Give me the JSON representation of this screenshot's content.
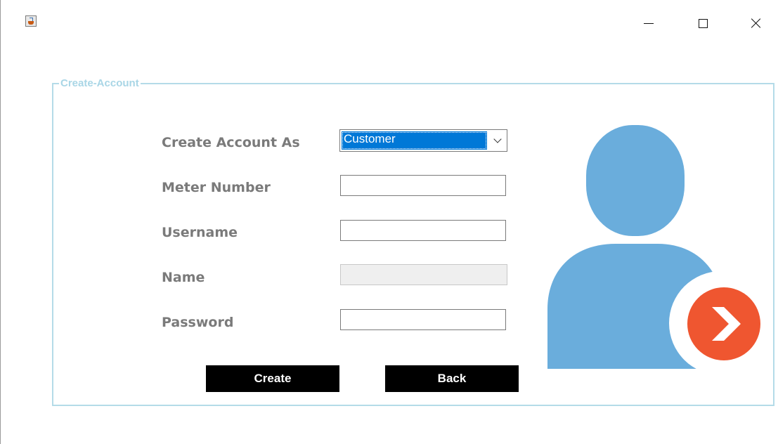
{
  "window": {
    "title": "",
    "app_icon": "java-cup-icon",
    "controls": {
      "minimize_icon": "minimize-icon",
      "maximize_icon": "maximize-icon",
      "close_icon": "close-icon"
    }
  },
  "form": {
    "group_title": "Create-Account",
    "fields": {
      "account_type": {
        "label": "Create Account As",
        "selected": "Customer"
      },
      "meter_number": {
        "label": "Meter Number",
        "value": ""
      },
      "username": {
        "label": "Username",
        "value": ""
      },
      "name": {
        "label": "Name",
        "value": ""
      },
      "password": {
        "label": "Password",
        "value": ""
      }
    },
    "buttons": {
      "create": "Create",
      "back": "Back"
    }
  },
  "illustration": {
    "icon": "user-arrow-icon",
    "colors": {
      "person": "#6aaddc",
      "badge": "#ef5630"
    }
  },
  "colors": {
    "group_border": "#b4dbe8",
    "group_title": "#a9d6e6",
    "label": "#7a7a7a",
    "button_bg": "#000000",
    "button_text": "#ffffff",
    "selection": "#0078d7"
  }
}
